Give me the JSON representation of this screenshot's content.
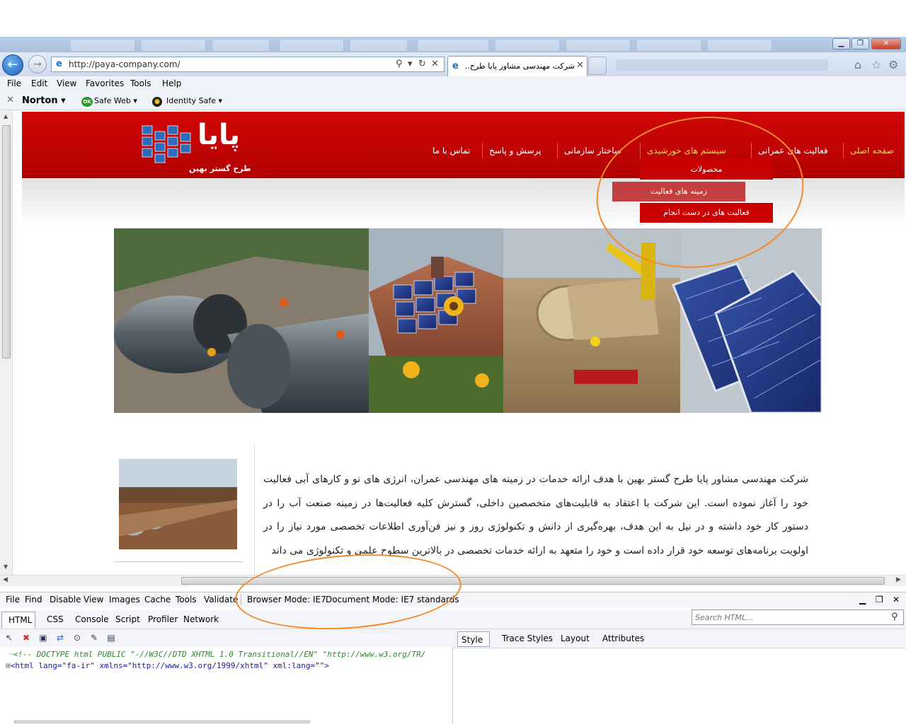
{
  "browser": {
    "url": "http://paya-company.com/",
    "tab_title": "شرکت مهندسی مشاور پایا طرح...",
    "menu": [
      "File",
      "Edit",
      "View",
      "Favorites",
      "Tools",
      "Help"
    ],
    "toolbar": {
      "norton": "Norton",
      "safe_web": "Safe Web",
      "identity_safe": "Identity Safe",
      "ok_badge": "OK"
    }
  },
  "site": {
    "logo_text": "پایا",
    "logo_sub": "طرح گستر بهین",
    "nav": [
      "صفحه اصلی",
      "فعالیت های عمرانی",
      "سیستم های خورشیدی",
      "ساختار سازمانی",
      "پرسش و پاسخ",
      "تماس با ما"
    ],
    "submenu": [
      "محصولات",
      "زمینه های فعالیت",
      "فعالیت های در دست انجام"
    ],
    "intro": "شرکت مهندسی مشاور پایا طرح گستر بهین با هدف ارائه خدمات در زمینه های مهندسی عمران، انرژی های نو و کارهای آبی فعالیت خود را آغاز نموده است. این شرکت با اعتقاد به قابلیت‌های متخصصین داخلی، گسترش کلیه فعالیت‌ها در زمینه صنعت آب را در دستور کار خود داشته و در نیل به این هدف، بهره‌گیری از دانش و تکنولوژی روز و نیز فن‌آوری اطلاعات تخصصی مورد نیاز را در اولویت برنامه‌های توسعه خود قرار داده است و خود را متعهد به ارائه خدمات تخصصی در بالاترین سطوح علمی و تکنولوژی می داند"
  },
  "devtools": {
    "menu": [
      "File",
      "Find",
      "Disable",
      "View",
      "Images",
      "Cache",
      "Tools",
      "Validate"
    ],
    "browser_mode": "Browser Mode: IE7",
    "document_mode": "Document Mode: IE7 standards",
    "tabs": [
      "HTML",
      "CSS",
      "Console",
      "Script",
      "Profiler",
      "Network"
    ],
    "search_placeholder": "Search HTML...",
    "style_tabs": [
      "Style",
      "Trace Styles",
      "Layout",
      "Attributes"
    ],
    "tree": [
      "<!-- DOCTYPE html PUBLIC \"-//W3C//DTD XHTML 1.0 Transitional//EN\" \"http://www.w3.org/TR/",
      "<html lang=\"fa-ir\" xmlns=\"http://www.w3.org/1999/xhtml\" xml:lang=\"\">"
    ]
  },
  "colors": {
    "header_red": "#c80000",
    "nav_highlight": "#f6d25e",
    "annotation": "#f48a2a"
  }
}
